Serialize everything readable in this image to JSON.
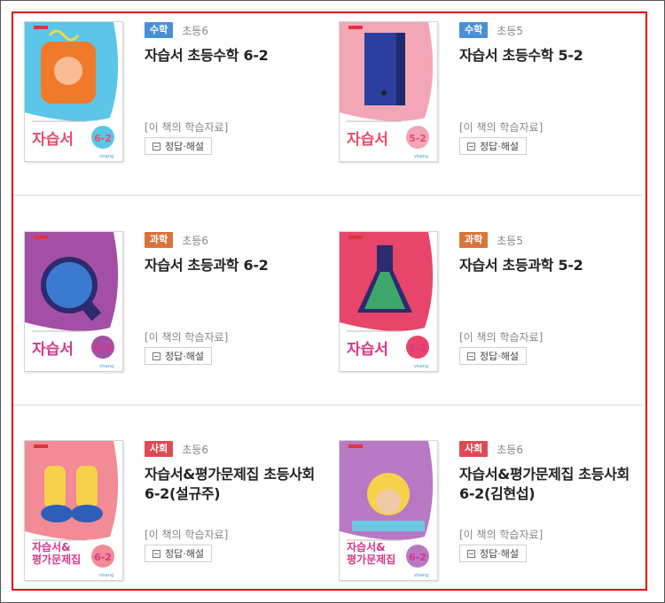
{
  "books": [
    {
      "subject": "수학",
      "subject_color": "#4a90d9",
      "grade": "초등6",
      "title": "자습서 초등수학 6-2",
      "resource_link": "[이 책의 학습자료]",
      "answer_label": "정답·해설",
      "cover_word": "자습서",
      "cover_grade": "6-2",
      "cover_theme": "#5bc6e8",
      "cover_accent": "#e84c6b"
    },
    {
      "subject": "수학",
      "subject_color": "#4a90d9",
      "grade": "초등5",
      "title": "자습서 초등수학 5-2",
      "resource_link": "[이 책의 학습자료]",
      "answer_label": "정답·해설",
      "cover_word": "자습서",
      "cover_grade": "5-2",
      "cover_theme": "#f3a6b6",
      "cover_accent": "#e84c6b"
    },
    {
      "subject": "과학",
      "subject_color": "#d9743a",
      "grade": "초등6",
      "title": "자습서 초등과학 6-2",
      "resource_link": "[이 책의 학습자료]",
      "answer_label": "정답·해설",
      "cover_word": "자습서",
      "cover_grade": "6-2",
      "cover_theme": "#a44fa6",
      "cover_accent": "#d7368a"
    },
    {
      "subject": "과학",
      "subject_color": "#d9743a",
      "grade": "초등5",
      "title": "자습서 초등과학 5-2",
      "resource_link": "[이 책의 학습자료]",
      "answer_label": "정답·해설",
      "cover_word": "자습서",
      "cover_grade": "5-2",
      "cover_theme": "#e8456a",
      "cover_accent": "#d7368a"
    },
    {
      "subject": "사회",
      "subject_color": "#e04a55",
      "grade": "초등6",
      "title": "자습서&평가문제집 초등사회 6-2(설규주)",
      "resource_link": "[이 책의 학습자료]",
      "answer_label": "정답·해설",
      "cover_word": "자습서& 평가문제집",
      "cover_grade": "6-2",
      "cover_theme": "#f28b95",
      "cover_accent": "#d7368a"
    },
    {
      "subject": "사회",
      "subject_color": "#e04a55",
      "grade": "초등6",
      "title": "자습서&평가문제집 초등사회 6-2(김현섭)",
      "resource_link": "[이 책의 학습자료]",
      "answer_label": "정답·해설",
      "cover_word": "자습서& 평가문제집",
      "cover_grade": "6-2",
      "cover_theme": "#b978c4",
      "cover_accent": "#d7368a"
    }
  ]
}
